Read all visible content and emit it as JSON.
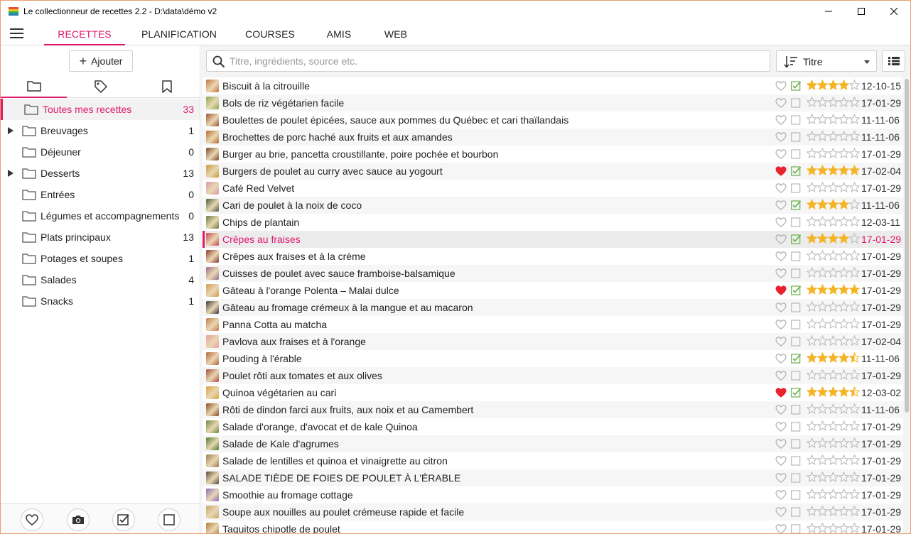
{
  "window": {
    "title": "Le collectionneur de recettes 2.2 - D:\\data\\démo v2",
    "minimize_icon": "minimize-icon",
    "maximize_icon": "maximize-icon",
    "close_icon": "close-icon"
  },
  "menu": {
    "tabs": [
      {
        "label": "RECETTES",
        "active": true
      },
      {
        "label": "PLANIFICATION",
        "active": false
      },
      {
        "label": "COURSES",
        "active": false
      },
      {
        "label": "AMIS",
        "active": false
      },
      {
        "label": "WEB",
        "active": false
      }
    ]
  },
  "sidebar": {
    "add_label": "Ajouter",
    "tab_icons": [
      "folder-icon",
      "tag-icon",
      "bookmark-icon"
    ],
    "categories": [
      {
        "label": "Toutes mes recettes",
        "count": "33",
        "active": true,
        "expandable": false
      },
      {
        "label": "Breuvages",
        "count": "1",
        "active": false,
        "expandable": true
      },
      {
        "label": "Déjeuner",
        "count": "0",
        "active": false,
        "expandable": false
      },
      {
        "label": "Desserts",
        "count": "13",
        "active": false,
        "expandable": true
      },
      {
        "label": "Entrées",
        "count": "0",
        "active": false,
        "expandable": false
      },
      {
        "label": "Légumes et accompagnements",
        "count": "0",
        "active": false,
        "expandable": false
      },
      {
        "label": "Plats principaux",
        "count": "13",
        "active": false,
        "expandable": false
      },
      {
        "label": "Potages et soupes",
        "count": "1",
        "active": false,
        "expandable": false
      },
      {
        "label": "Salades",
        "count": "4",
        "active": false,
        "expandable": false
      },
      {
        "label": "Snacks",
        "count": "1",
        "active": false,
        "expandable": false
      }
    ],
    "bottom_icons": [
      "heart-icon",
      "camera-icon",
      "checkbox-checked-icon",
      "checkbox-empty-icon"
    ]
  },
  "toolbar": {
    "search_placeholder": "Titre, ingrédients, source etc.",
    "sort_label": "Titre",
    "view_icon": "list-view-icon"
  },
  "colors": {
    "accent": "#e0196b",
    "star": "#f5b428",
    "heart_fav": "#e8232e",
    "check": "#6ab04c"
  },
  "recipes": [
    {
      "title": "Biscuit à la citrouille",
      "fav": false,
      "done": true,
      "rating": 4,
      "date": "12-10-15",
      "thumb": "#c8743a"
    },
    {
      "title": "Bols de riz végétarien facile",
      "fav": false,
      "done": false,
      "rating": 0,
      "date": "17-01-29",
      "thumb": "#8aa84a"
    },
    {
      "title": "Boulettes de poulet épicées, sauce aux pommes du Québec et cari thaïlandais",
      "fav": false,
      "done": false,
      "rating": 0,
      "date": "11-11-06",
      "thumb": "#a0522d"
    },
    {
      "title": "Brochettes de porc haché aux fruits et aux amandes",
      "fav": false,
      "done": false,
      "rating": 0,
      "date": "11-11-06",
      "thumb": "#b86b2e"
    },
    {
      "title": "Burger au brie, pancetta croustillante, poire pochée et bourbon",
      "fav": false,
      "done": false,
      "rating": 0,
      "date": "17-01-29",
      "thumb": "#7a4a2a"
    },
    {
      "title": "Burgers de poulet au curry avec sauce au yogourt",
      "fav": true,
      "done": true,
      "rating": 5,
      "date": "17-02-04",
      "thumb": "#c89a3a"
    },
    {
      "title": "Café Red Velvet",
      "fav": false,
      "done": false,
      "rating": 0,
      "date": "17-01-29",
      "thumb": "#d89aa8"
    },
    {
      "title": "Cari de poulet à la noix de coco",
      "fav": false,
      "done": true,
      "rating": 4,
      "date": "11-11-06",
      "thumb": "#4a5a3a"
    },
    {
      "title": "Chips de plantain",
      "fav": false,
      "done": false,
      "rating": 0,
      "date": "12-03-11",
      "thumb": "#6a7a3a"
    },
    {
      "title": "Crêpes au fraises",
      "fav": false,
      "done": true,
      "rating": 4,
      "date": "17-01-29",
      "thumb": "#c8464a",
      "selected": true
    },
    {
      "title": "Crêpes aux fraises et à la crème",
      "fav": false,
      "done": false,
      "rating": 0,
      "date": "17-01-29",
      "thumb": "#8a3a2a"
    },
    {
      "title": "Cuisses de poulet avec sauce framboise-balsamique",
      "fav": false,
      "done": false,
      "rating": 0,
      "date": "17-01-29",
      "thumb": "#9a6a8a"
    },
    {
      "title": "Gâteau à l'orange Polenta – Malai dulce",
      "fav": true,
      "done": true,
      "rating": 5,
      "date": "17-01-29",
      "thumb": "#d89a4a"
    },
    {
      "title": "Gâteau au fromage crémeux à la mangue et au macaron",
      "fav": false,
      "done": false,
      "rating": 0,
      "date": "17-01-29",
      "thumb": "#3a3a3a"
    },
    {
      "title": "Panna Cotta au matcha",
      "fav": false,
      "done": false,
      "rating": 0,
      "date": "17-01-29",
      "thumb": "#c87a4a"
    },
    {
      "title": "Pavlova aux fraises et à l'orange",
      "fav": false,
      "done": false,
      "rating": 0,
      "date": "17-02-04",
      "thumb": "#e8a0a0"
    },
    {
      "title": "Pouding à l'érable",
      "fav": false,
      "done": true,
      "rating": 4.5,
      "date": "11-11-06",
      "thumb": "#b8623a"
    },
    {
      "title": "Poulet rôti aux tomates et aux olives",
      "fav": false,
      "done": false,
      "rating": 0,
      "date": "17-01-29",
      "thumb": "#a84a3a"
    },
    {
      "title": "Quinoa végétarien au cari",
      "fav": true,
      "done": true,
      "rating": 4.5,
      "date": "12-03-02",
      "thumb": "#d8a43a"
    },
    {
      "title": "Rôti de dindon farci aux fruits, aux noix et au Camembert",
      "fav": false,
      "done": false,
      "rating": 0,
      "date": "11-11-06",
      "thumb": "#8a4a1a"
    },
    {
      "title": "Salade d'orange, d'avocat et de kale Quinoa",
      "fav": false,
      "done": false,
      "rating": 0,
      "date": "17-01-29",
      "thumb": "#6a8a3a"
    },
    {
      "title": "Salade de Kale d'agrumes",
      "fav": false,
      "done": false,
      "rating": 0,
      "date": "17-01-29",
      "thumb": "#4a7a2a"
    },
    {
      "title": "Salade de lentilles et quinoa et vinaigrette au citron",
      "fav": false,
      "done": false,
      "rating": 0,
      "date": "17-01-29",
      "thumb": "#9a7a4a"
    },
    {
      "title": "SALADE TIÈDE DE FOIES DE POULET À L'ÉRABLE",
      "fav": false,
      "done": false,
      "rating": 0,
      "date": "17-01-29",
      "thumb": "#5a4a3a"
    },
    {
      "title": "Smoothie au fromage cottage",
      "fav": false,
      "done": false,
      "rating": 0,
      "date": "17-01-29",
      "thumb": "#8a6ab8"
    },
    {
      "title": "Soupe aux nouilles au poulet crémeuse rapide et facile",
      "fav": false,
      "done": false,
      "rating": 0,
      "date": "17-01-29",
      "thumb": "#c8a86a"
    },
    {
      "title": "Taquitos chipotle de poulet",
      "fav": false,
      "done": false,
      "rating": 0,
      "date": "17-01-29",
      "thumb": "#b87a3a"
    }
  ]
}
